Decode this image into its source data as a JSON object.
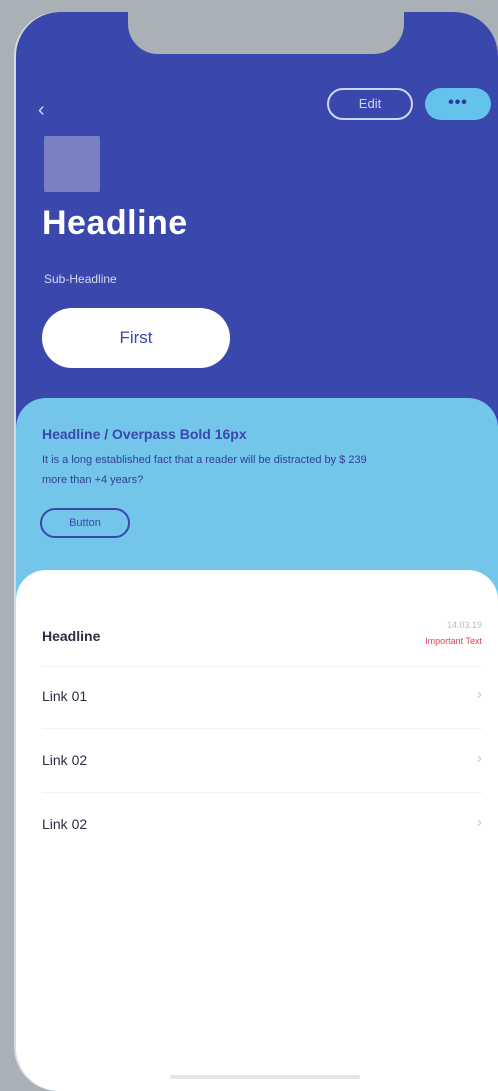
{
  "header": {
    "back_glyph": "‹",
    "edit_label": "Edit",
    "more_label": "•••",
    "headline": "Headline",
    "subheadline": "Sub-Headline",
    "first_button": "First"
  },
  "promo": {
    "title": "Headline / Overpass Bold 16px",
    "text": "It is a long established fact that a reader will be distracted by $ 239 more than +4 years?",
    "button": "Button"
  },
  "list": {
    "headline": "Headline",
    "date": "14.03.19",
    "important": "Important Text",
    "links": [
      {
        "label": "Link 01",
        "chevron": "›"
      },
      {
        "label": "Link 02",
        "chevron": "›"
      },
      {
        "label": "Link 02",
        "chevron": "›"
      }
    ]
  },
  "colors": {
    "header_bg": "#3a47ac",
    "promo_bg": "#73c5ea",
    "accent": "#63c3eb",
    "important": "#e0405a"
  }
}
